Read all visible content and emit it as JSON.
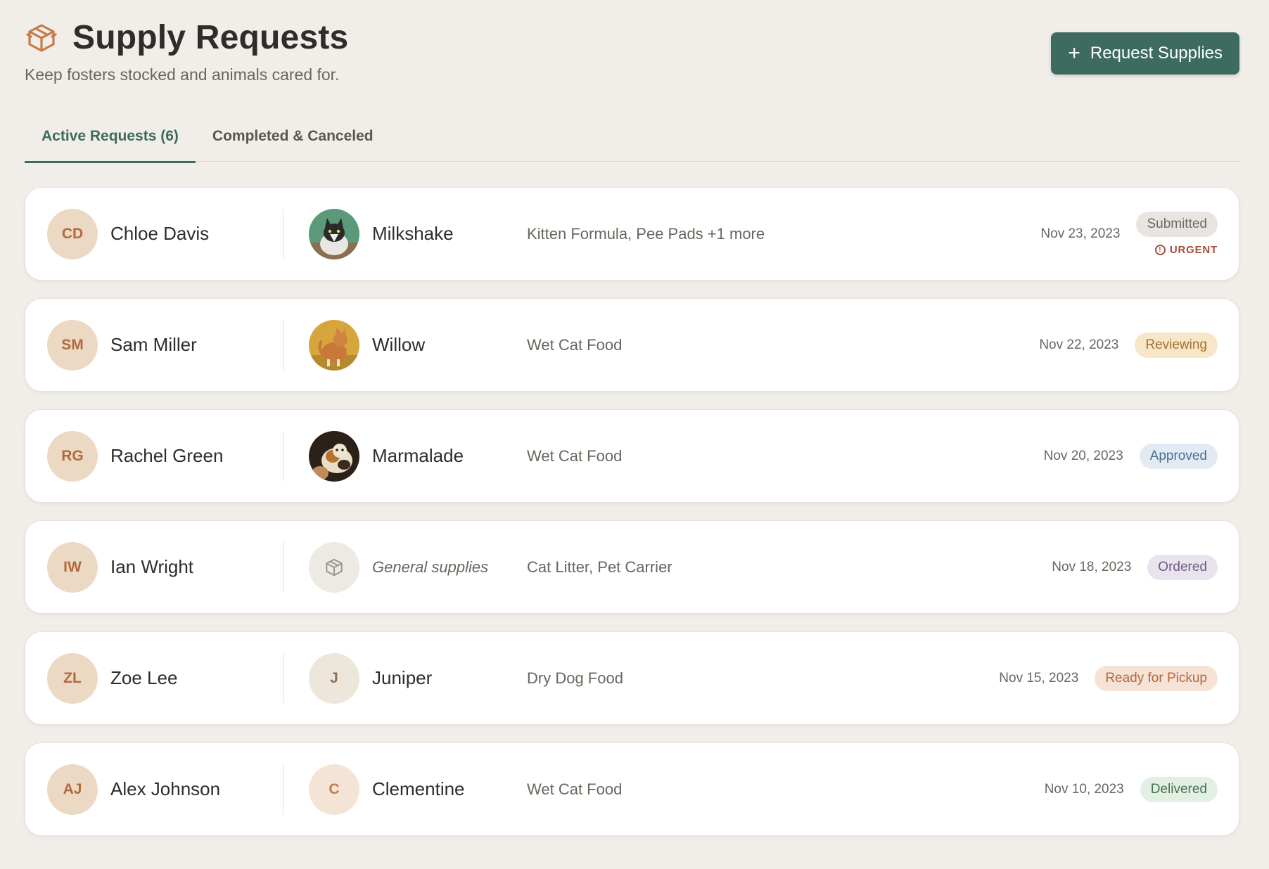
{
  "header": {
    "title": "Supply Requests",
    "subtitle": "Keep fosters stocked and animals cared for.",
    "title_icon": "box-icon",
    "action_button": "Request Supplies"
  },
  "tabs": [
    {
      "label": "Active Requests (6)",
      "active": true
    },
    {
      "label": "Completed & Canceled",
      "active": false
    }
  ],
  "colors": {
    "accent": "#3d6b60",
    "brand_icon": "#c97a4a",
    "background": "#f1eee9"
  },
  "requests": [
    {
      "initials": "CD",
      "name": "Chloe Davis",
      "pet": {
        "name": "Milkshake",
        "avatar": "photo-black-white-cat"
      },
      "items": "Kitten Formula, Pee Pads +1 more",
      "date": "Nov 23, 2023",
      "status": "Submitted",
      "urgent": "URGENT"
    },
    {
      "initials": "SM",
      "name": "Sam Miller",
      "pet": {
        "name": "Willow",
        "avatar": "photo-orange-cat"
      },
      "items": "Wet Cat Food",
      "date": "Nov 22, 2023",
      "status": "Reviewing"
    },
    {
      "initials": "RG",
      "name": "Rachel Green",
      "pet": {
        "name": "Marmalade",
        "avatar": "photo-calico-cat"
      },
      "items": "Wet Cat Food",
      "date": "Nov 20, 2023",
      "status": "Approved"
    },
    {
      "initials": "IW",
      "name": "Ian Wright",
      "pet": {
        "name": "General supplies",
        "avatar": "box-icon"
      },
      "items": "Cat Litter, Pet Carrier",
      "date": "Nov 18, 2023",
      "status": "Ordered"
    },
    {
      "initials": "ZL",
      "name": "Zoe Lee",
      "pet": {
        "name": "Juniper",
        "initial": "J"
      },
      "items": "Dry Dog Food",
      "date": "Nov 15, 2023",
      "status": "Ready for Pickup"
    },
    {
      "initials": "AJ",
      "name": "Alex Johnson",
      "pet": {
        "name": "Clementine",
        "initial": "C"
      },
      "items": "Wet Cat Food",
      "date": "Nov 10, 2023",
      "status": "Delivered"
    }
  ]
}
